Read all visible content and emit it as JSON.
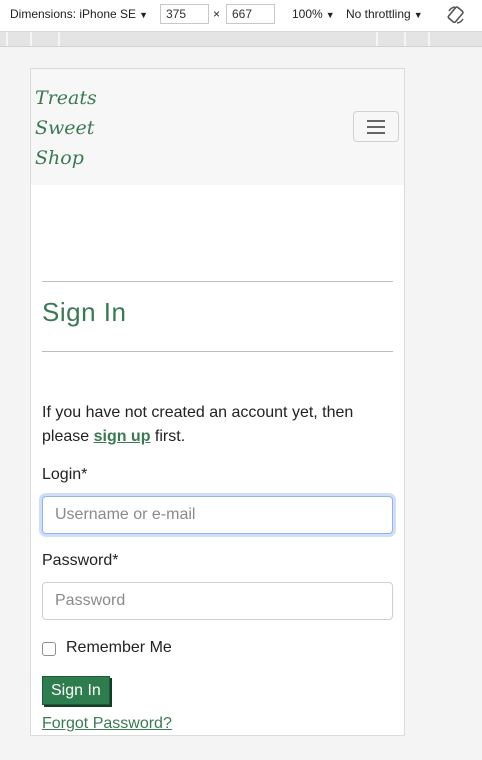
{
  "devtools": {
    "dimensions_label": "Dimensions: iPhone SE",
    "width_value": "375",
    "times": "×",
    "height_value": "667",
    "zoom": "100%",
    "throttling": "No throttling",
    "caret": "▼",
    "rotate_icon": "rotate-icon"
  },
  "navbar": {
    "brand_line1": "Treats",
    "brand_line2": "Sweet",
    "brand_line3": "Shop",
    "toggler_icon": "hamburger-icon"
  },
  "signin": {
    "title": "Sign In",
    "intro_prefix": "If you have not created an account yet, then please ",
    "signup_link": "sign up",
    "intro_suffix": " first.",
    "login_label": "Login*",
    "login_placeholder": "Username or e-mail",
    "login_value": "",
    "password_label": "Password*",
    "password_placeholder": "Password",
    "password_value": "",
    "remember_label": "Remember Me",
    "remember_checked": false,
    "submit_label": "Sign In",
    "forgot_link": "Forgot Password?"
  },
  "colors": {
    "brand_green": "#3a7a52",
    "button_green": "#2e7d4f",
    "focus_ring": "#8fb4f5"
  }
}
